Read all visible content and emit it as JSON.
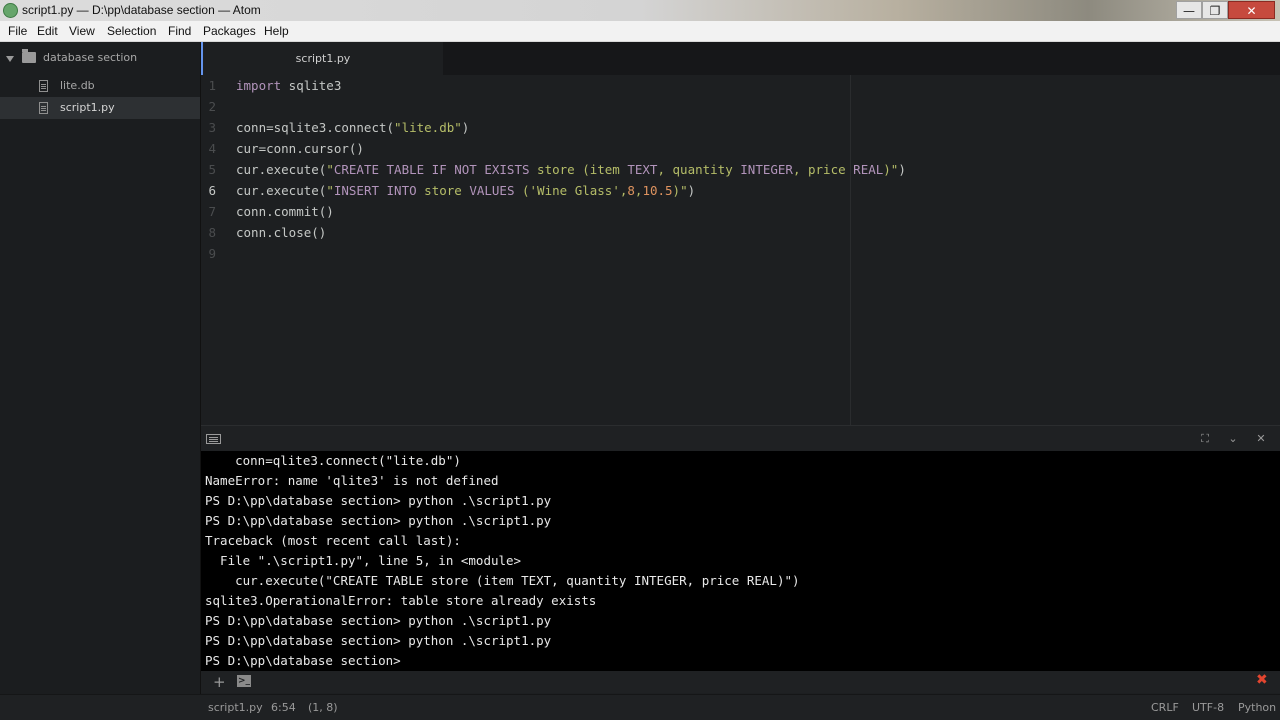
{
  "window": {
    "title": "script1.py — D:\\pp\\database section — Atom",
    "min": "—",
    "max": "❐",
    "close": "✕"
  },
  "menu": [
    "File",
    "Edit",
    "View",
    "Selection",
    "Find",
    "Packages",
    "Help"
  ],
  "tree": {
    "root": "database section",
    "items": [
      "lite.db",
      "script1.py"
    ],
    "selected": "script1.py"
  },
  "tab": {
    "label": "script1.py"
  },
  "editor": {
    "active_line": 6,
    "lines": [
      {
        "n": "1",
        "parts": [
          [
            "kw",
            "import"
          ],
          [
            "",
            " sqlite3"
          ]
        ]
      },
      {
        "n": "2",
        "parts": []
      },
      {
        "n": "3",
        "parts": [
          [
            "",
            "conn=sqlite3.connect("
          ],
          [
            "str",
            "\"lite.db\""
          ],
          [
            "",
            ")"
          ]
        ]
      },
      {
        "n": "4",
        "parts": [
          [
            "",
            "cur=conn.cursor()"
          ]
        ]
      },
      {
        "n": "5",
        "parts": [
          [
            "",
            "cur.execute("
          ],
          [
            "str",
            "\""
          ],
          [
            "sqlkw",
            "CREATE TABLE IF NOT EXISTS"
          ],
          [
            "str",
            " store (item "
          ],
          [
            "sqlkw",
            "TEXT"
          ],
          [
            "str",
            ", quantity "
          ],
          [
            "sqlkw",
            "INTEGER"
          ],
          [
            "str",
            ", price "
          ],
          [
            "sqlkw",
            "REAL"
          ],
          [
            "str",
            ")\""
          ],
          [
            "",
            ")"
          ]
        ]
      },
      {
        "n": "6",
        "parts": [
          [
            "",
            "cur.execute("
          ],
          [
            "str",
            "\""
          ],
          [
            "sqlkw",
            "INSERT INTO"
          ],
          [
            "str",
            " store "
          ],
          [
            "sqlkw",
            "VALUES"
          ],
          [
            "str",
            " ('Wine Glass',"
          ],
          [
            "num",
            "8"
          ],
          [
            "str",
            ","
          ],
          [
            "num",
            "10.5"
          ],
          [
            "str",
            ")\""
          ],
          [
            "",
            ")"
          ]
        ]
      },
      {
        "n": "7",
        "parts": [
          [
            "",
            "conn.commit()"
          ]
        ]
      },
      {
        "n": "8",
        "parts": [
          [
            "",
            "conn.close()"
          ]
        ]
      },
      {
        "n": "9",
        "parts": []
      }
    ]
  },
  "terminal": {
    "lines": [
      "    conn=qlite3.connect(\"lite.db\")",
      "NameError: name 'qlite3' is not defined",
      "PS D:\\pp\\database section> python .\\script1.py",
      "PS D:\\pp\\database section> python .\\script1.py",
      "Traceback (most recent call last):",
      "  File \".\\script1.py\", line 5, in <module>",
      "    cur.execute(\"CREATE TABLE store (item TEXT, quantity INTEGER, price REAL)\")",
      "sqlite3.OperationalError: table store already exists",
      "PS D:\\pp\\database section> python .\\script1.py",
      "PS D:\\pp\\database section> python .\\script1.py",
      "PS D:\\pp\\database section> "
    ]
  },
  "terminal_footer": {
    "add": "+",
    "terminal_glyph": ">_",
    "error_glyph": "✖"
  },
  "panel_buttons": {
    "maximize": "⛶",
    "hide": "⌄",
    "close": "✕"
  },
  "status": {
    "file": "script1.py",
    "cursor": "6:54",
    "selection": "(1, 8)",
    "line_ending": "CRLF",
    "encoding": "UTF-8",
    "grammar": "Python"
  },
  "colors": {
    "accent": "#6494ed",
    "keyword": "#b294bb",
    "string": "#b5bd68",
    "number": "#de935f",
    "error": "#e2452f"
  }
}
